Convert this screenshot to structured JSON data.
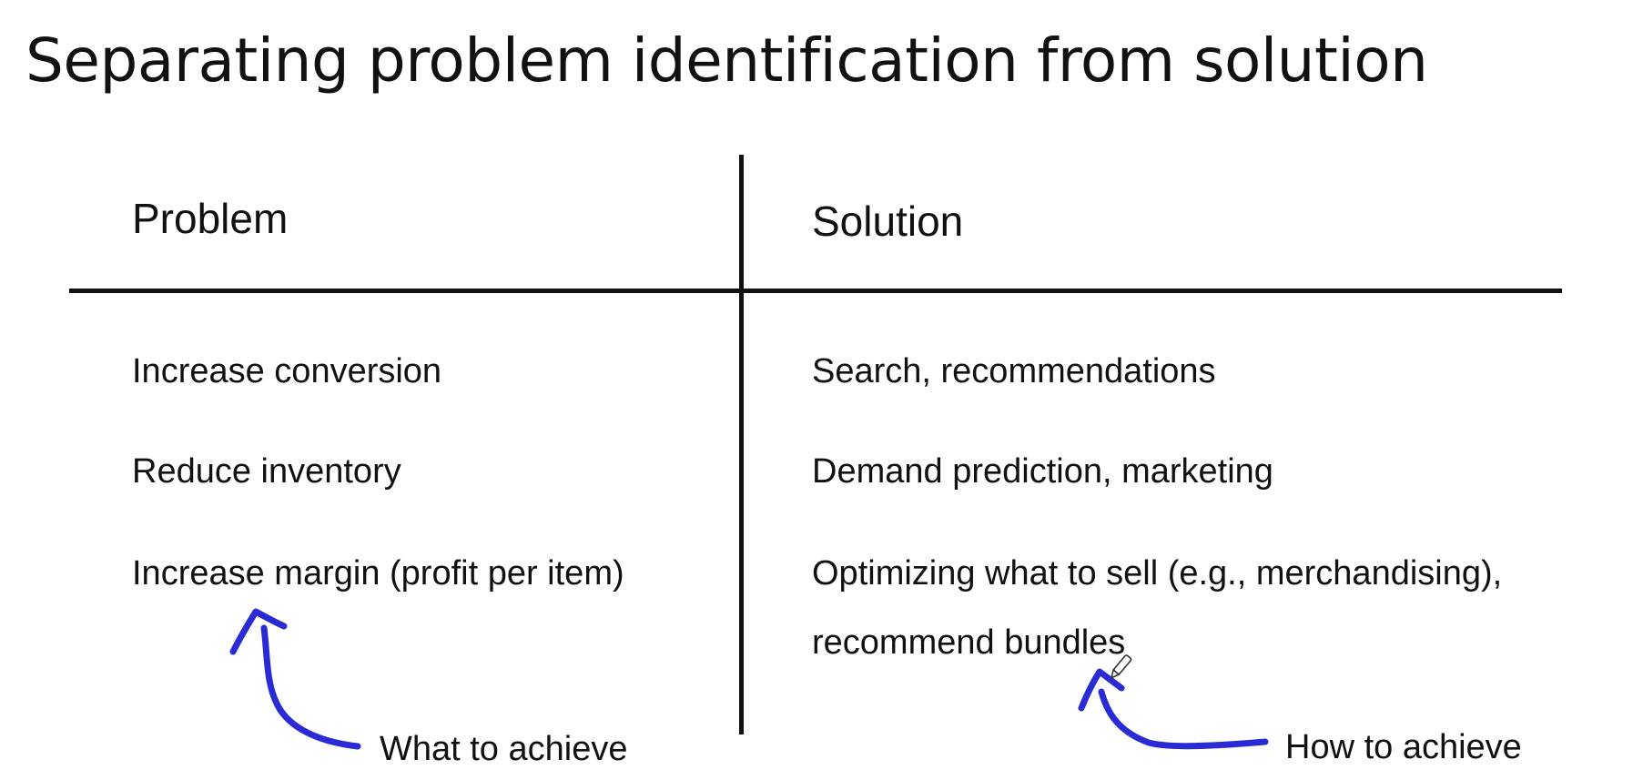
{
  "title": "Separating problem identification from solution",
  "columns": {
    "left_header": "Problem",
    "right_header": "Solution"
  },
  "rows": [
    {
      "problem": "Increase conversion",
      "solution": "Search, recommendations"
    },
    {
      "problem": "Reduce inventory",
      "solution": "Demand prediction, marketing"
    },
    {
      "problem": "Increase margin (profit per item)",
      "solution": "Optimizing what to sell (e.g., merchandising),",
      "solution_line2": "recommend bundles"
    }
  ],
  "annotations": {
    "left": "What to achieve",
    "right": "How to achieve"
  },
  "colors": {
    "text": "#111111",
    "ink": "#2b2bd6",
    "background": "#ffffff"
  },
  "icons": {
    "cursor": "pen-cursor-icon"
  }
}
